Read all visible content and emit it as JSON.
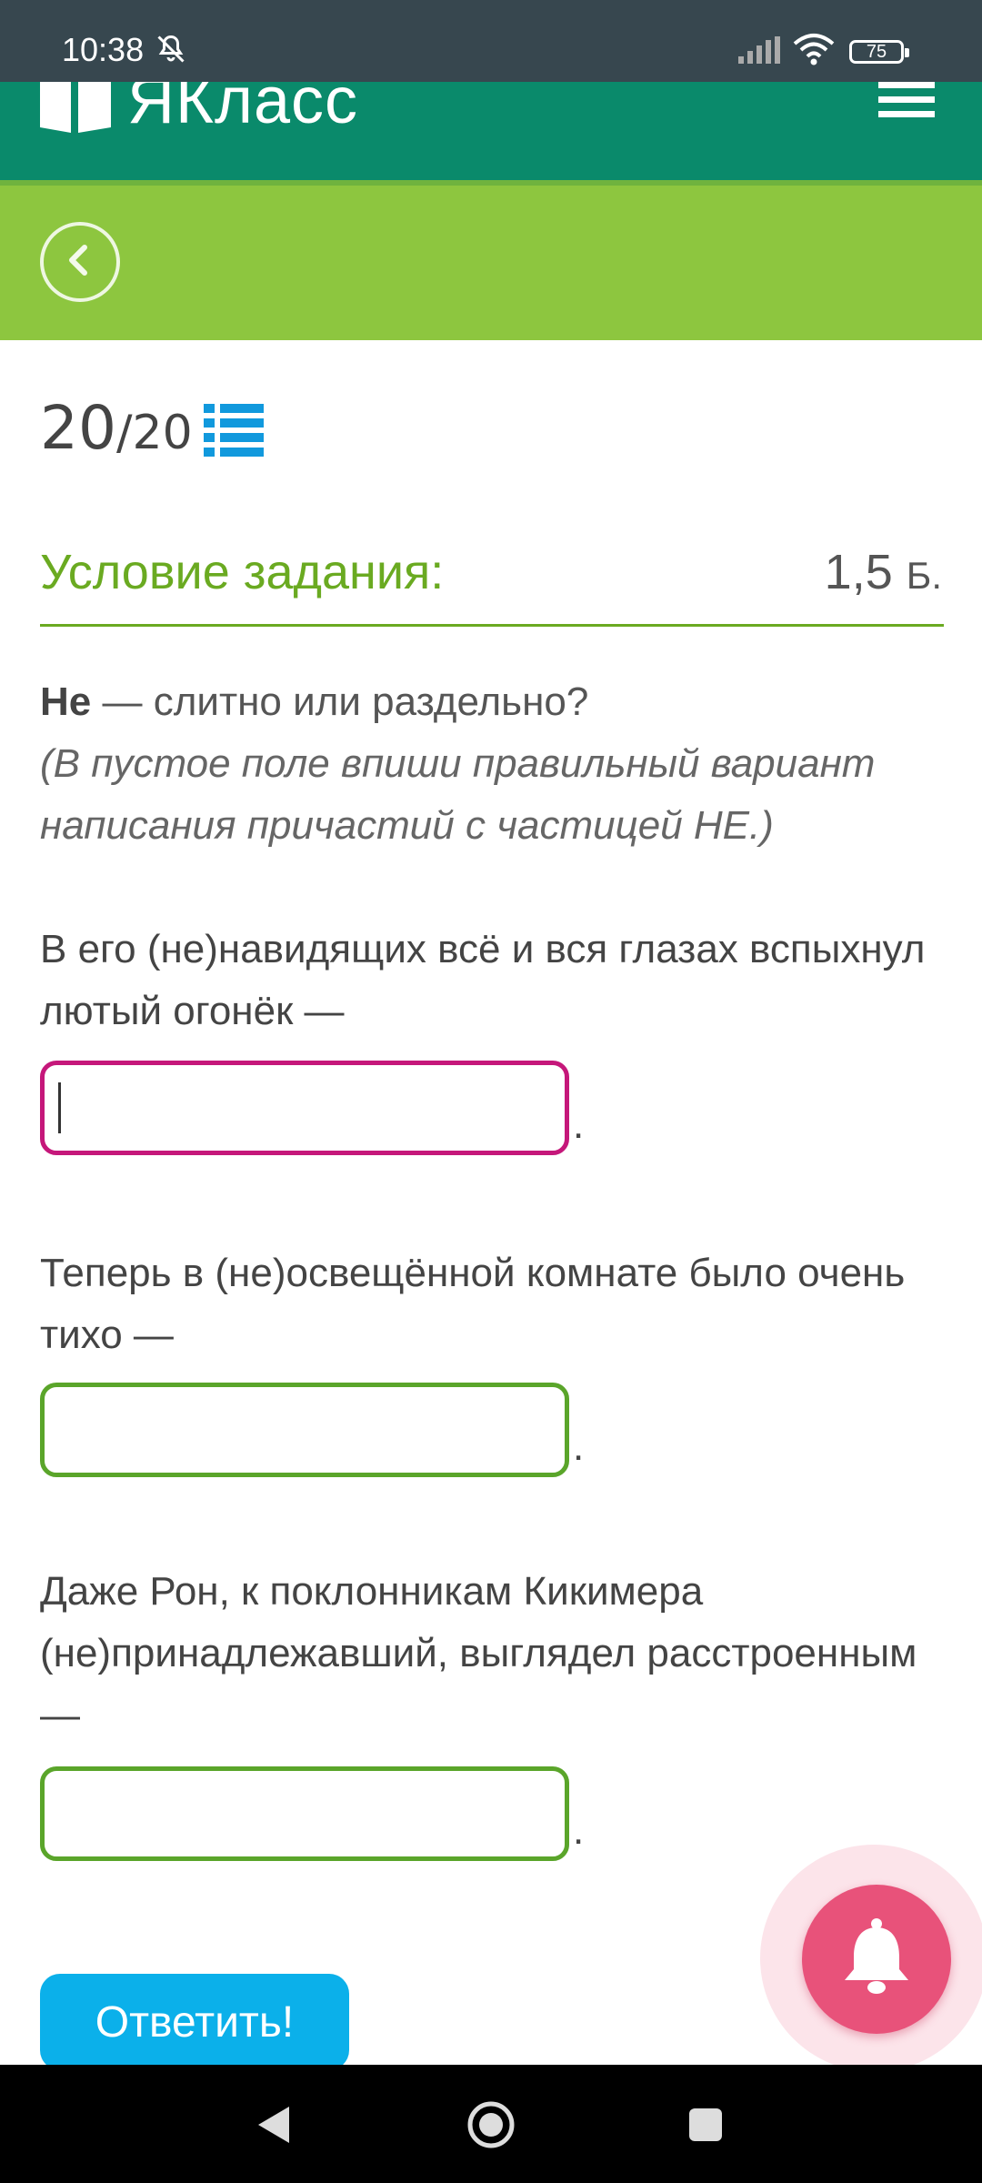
{
  "status": {
    "time": "10:38",
    "battery": "75"
  },
  "header": {
    "brand": "ЯКласс"
  },
  "counter": {
    "current": "20",
    "total": "/20"
  },
  "task": {
    "title": "Условие задания:",
    "points_value": "1,5",
    "points_unit": "Б.",
    "instruction_bold": "Не",
    "instruction_rest": " — слитно или раздельно?",
    "hint": "(В пустое поле впиши правильный вариант написания причастий с частицей НЕ.)"
  },
  "questions": [
    {
      "text": "В его (не)навидящих всё и вся глазах вспыхнул лютый огонёк —",
      "answer": "",
      "trail": "."
    },
    {
      "text": "Теперь в (не)освещённой комнате было очень тихо —",
      "answer": "",
      "trail": "."
    },
    {
      "text": "Даже Рон, к поклонникам Кикимера (не)принадлежавший, выглядел расстроенным —",
      "answer": "",
      "trail": "."
    }
  ],
  "submit_label": "Ответить!",
  "colors": {
    "header_bg": "#0a8a6b",
    "subheader_bg": "#8dc63f",
    "title_green": "#6aaa21",
    "active_input": "#c5177a",
    "submit_bg": "#0bb0ea",
    "bell_bg": "#e8527a"
  },
  "icons": {
    "logo": "book-icon",
    "menu": "hamburger-menu-icon",
    "back": "chevron-left-icon",
    "list": "list-icon",
    "bell": "bell-icon",
    "nav": [
      "back-triangle-icon",
      "home-circle-icon",
      "recents-square-icon"
    ]
  }
}
